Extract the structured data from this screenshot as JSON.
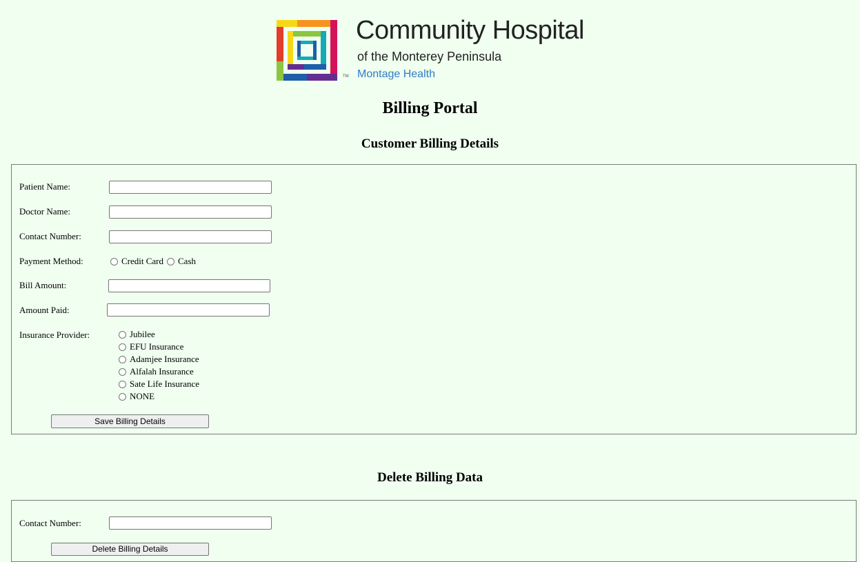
{
  "brand": {
    "name": "Community Hospital",
    "subtitle": "of the Monterey Peninsula",
    "parent": "Montage Health",
    "trademark": "TM",
    "logo_colors": [
      "#e23c2a",
      "#f7941d",
      "#f6d816",
      "#8cc63f",
      "#17a9b5",
      "#1f5ea8",
      "#662d91",
      "#d4145a"
    ]
  },
  "page": {
    "title": "Billing Portal"
  },
  "billing": {
    "section_title": "Customer Billing Details",
    "patient_name": {
      "label": "Patient Name:",
      "value": ""
    },
    "doctor_name": {
      "label": "Doctor Name:",
      "value": ""
    },
    "contact_number": {
      "label": "Contact Number:",
      "value": ""
    },
    "payment_method": {
      "label": "Payment Method:",
      "options": [
        "Credit Card",
        "Cash"
      ]
    },
    "bill_amount": {
      "label": "Bill Amount:",
      "value": ""
    },
    "amount_paid": {
      "label": "Amount Paid:",
      "value": ""
    },
    "insurance_provider": {
      "label": "Insurance Provider:",
      "options": [
        "Jubilee",
        "EFU Insurance",
        "Adamjee Insurance",
        "Alfalah Insurance",
        "Sate Life Insurance",
        "NONE"
      ]
    },
    "save_button": "Save Billing Details"
  },
  "delete": {
    "section_title": "Delete Billing Data",
    "contact_number": {
      "label": "Contact Number:",
      "value": ""
    },
    "delete_button": "Delete Billing Details"
  }
}
